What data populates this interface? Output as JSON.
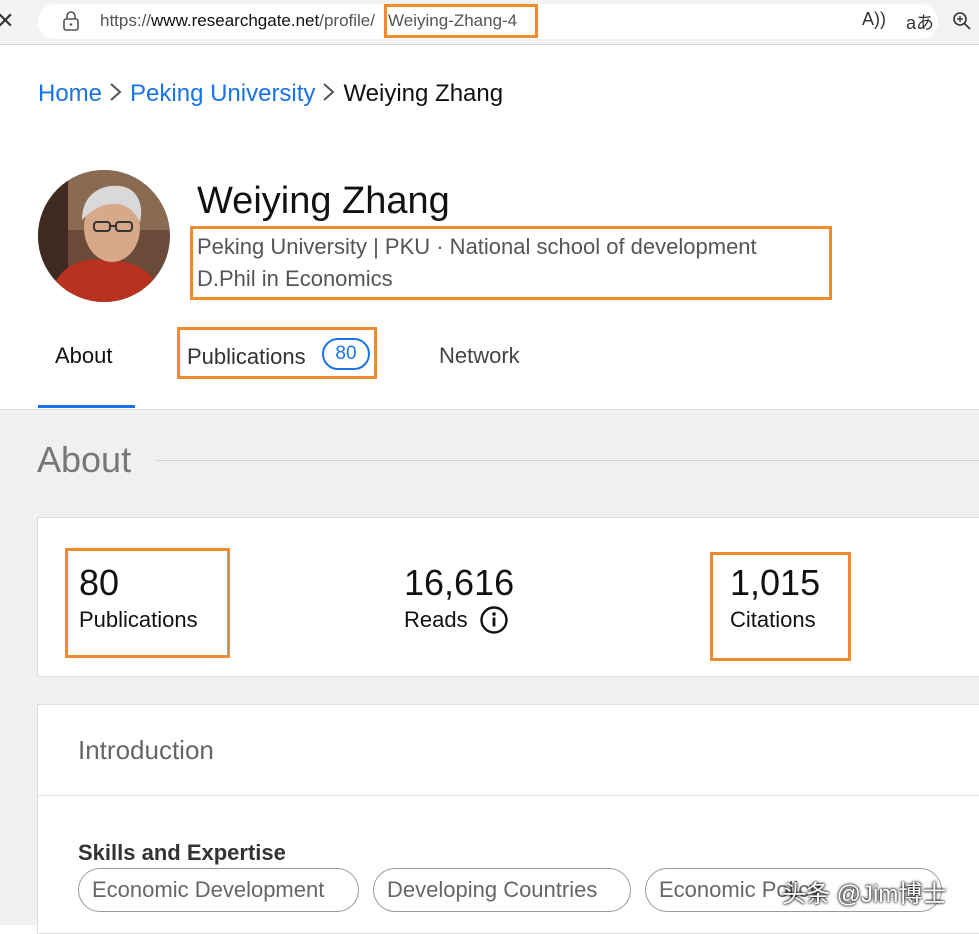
{
  "browser": {
    "url_base": "https://www.researchgate.net/profile/",
    "url_host": "www.researchgate.net",
    "url_scheme": "https://",
    "url_path": "/profile/",
    "url_slug": "Weiying-Zhang-4",
    "read_aloud_icon": "A))",
    "translate_icon": "aあ"
  },
  "breadcrumb": {
    "home": "Home",
    "university": "Peking University",
    "current": "Weiying Zhang"
  },
  "profile": {
    "name": "Weiying Zhang",
    "affiliation": "Peking University | PKU · National school of development",
    "degree": "D.Phil in Economics"
  },
  "tabs": {
    "about": "About",
    "publications": "Publications",
    "publications_count": "80",
    "network": "Network"
  },
  "about": {
    "title": "About",
    "stats": {
      "publications_value": "80",
      "publications_label": "Publications",
      "reads_value": "16,616",
      "reads_label": "Reads",
      "citations_value": "1,015",
      "citations_label": "Citations"
    }
  },
  "introduction": {
    "title": "Introduction",
    "skills_heading": "Skills and Expertise",
    "skills": [
      "Economic Development",
      "Developing Countries",
      "Economic Policy"
    ]
  },
  "watermark": "头条 @Jim博士",
  "colors": {
    "link_blue": "#1a73e8",
    "highlight_orange": "#f28a2e"
  }
}
